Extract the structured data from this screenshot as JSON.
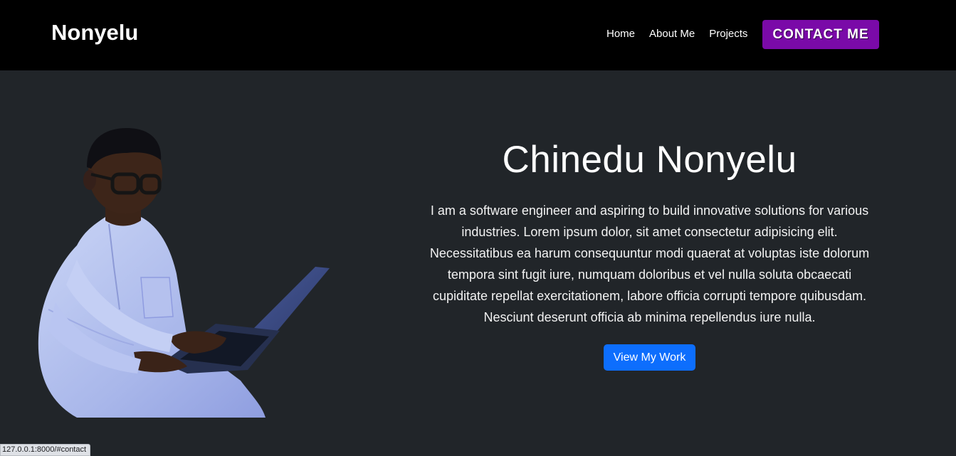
{
  "navbar": {
    "brand": "Nonyelu",
    "links": [
      {
        "label": "Home"
      },
      {
        "label": "About Me"
      },
      {
        "label": "Projects"
      }
    ],
    "cta_label": "CONTACT ME",
    "background": "#000000",
    "cta_color": "#7a0aa8"
  },
  "hero": {
    "title": "Chinedu Nonyelu",
    "description": "I am a software engineer and aspiring to build innovative solutions for various industries. Lorem ipsum dolor, sit amet consectetur adipisicing elit. Necessitatibus ea harum consequuntur modi quaerat at voluptas iste dolorum tempora sint fugit iure, numquam doloribus et vel nulla soluta obcaecati cupiditate repellat exercitationem, labore officia corrupti tempore quibusdam. Nesciunt deserunt officia ab minima repellendus iure nulla.",
    "button_label": "View My Work",
    "button_color": "#0d6efd",
    "background": "#212529",
    "photo": "portrait-with-laptop"
  },
  "status_bar": {
    "url": "127.0.0.1:8000/#contact"
  }
}
